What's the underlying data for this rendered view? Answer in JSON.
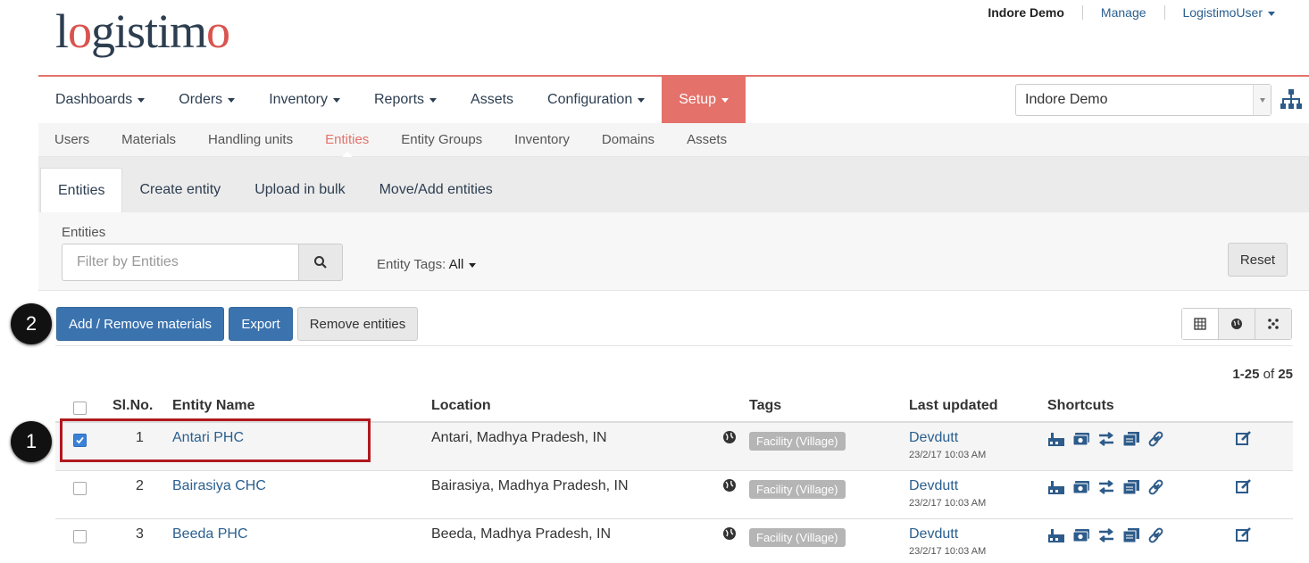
{
  "logo": {
    "part1": "l",
    "o1": "o",
    "part2": "gistim",
    "o2": "o"
  },
  "topbar": {
    "domain": "Indore Demo",
    "manage": "Manage",
    "user": "LogistimoUser"
  },
  "mainnav": [
    {
      "label": "Dashboards",
      "caret": true
    },
    {
      "label": "Orders",
      "caret": true
    },
    {
      "label": "Inventory",
      "caret": true
    },
    {
      "label": "Reports",
      "caret": true
    },
    {
      "label": "Assets",
      "caret": false
    },
    {
      "label": "Configuration",
      "caret": true
    },
    {
      "label": "Setup",
      "caret": true,
      "active": true
    }
  ],
  "domain_select": {
    "value": "Indore Demo"
  },
  "subnav": [
    "Users",
    "Materials",
    "Handling units",
    "Entities",
    "Entity Groups",
    "Inventory",
    "Domains",
    "Assets"
  ],
  "subnav_active": "Entities",
  "tabs": [
    "Entities",
    "Create entity",
    "Upload in bulk",
    "Move/Add entities"
  ],
  "filter": {
    "label": "Entities",
    "placeholder": "Filter by Entities",
    "tags_label": "Entity Tags:",
    "tags_value": "All",
    "reset": "Reset"
  },
  "actions": {
    "add_remove": "Add / Remove materials",
    "export": "Export",
    "remove": "Remove entities"
  },
  "pager": {
    "range": "1-25",
    "of": "of",
    "total": "25"
  },
  "table": {
    "headers": {
      "slno": "Sl.No.",
      "name": "Entity Name",
      "location": "Location",
      "tags": "Tags",
      "updated": "Last updated",
      "shortcuts": "Shortcuts"
    },
    "rows": [
      {
        "no": "1",
        "name": "Antari PHC",
        "location": "Antari, Madhya Pradesh, IN",
        "tag": "Facility (Village)",
        "user": "Devdutt",
        "time": "23/2/17 10:03 AM",
        "checked": true
      },
      {
        "no": "2",
        "name": "Bairasiya CHC",
        "location": "Bairasiya, Madhya Pradesh, IN",
        "tag": "Facility (Village)",
        "user": "Devdutt",
        "time": "23/2/17 10:03 AM",
        "checked": false
      },
      {
        "no": "3",
        "name": "Beeda PHC",
        "location": "Beeda, Madhya Pradesh, IN",
        "tag": "Facility (Village)",
        "user": "Devdutt",
        "time": "23/2/17 10:03 AM",
        "checked": false
      }
    ]
  },
  "callouts": {
    "one": "1",
    "two": "2"
  },
  "colors": {
    "accent": "#e4726a",
    "primary": "#3b73ae",
    "highlight": "#b0191e"
  }
}
